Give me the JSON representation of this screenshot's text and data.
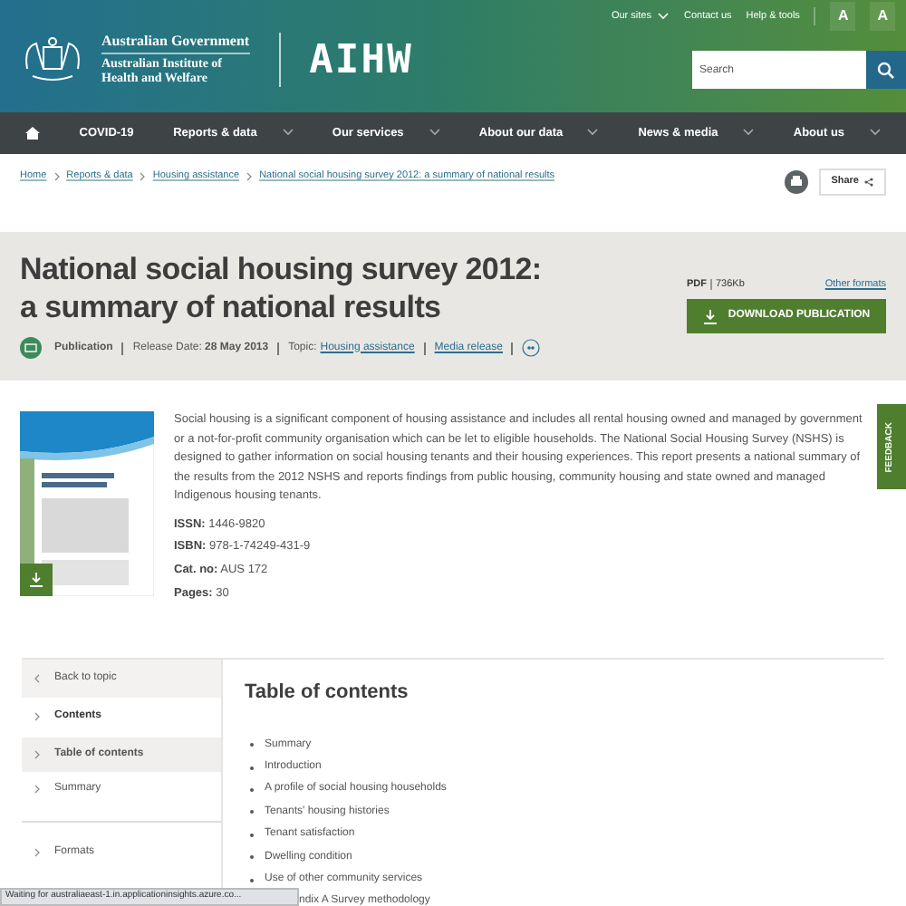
{
  "top_links": [
    {
      "label": "Our sites",
      "dropdown": true
    },
    {
      "label": "Contact us",
      "dropdown": false
    },
    {
      "label": "Help & tools",
      "dropdown": false
    }
  ],
  "font_buttons": [
    "A",
    "A"
  ],
  "logo": {
    "government": "Australian Government",
    "institute": "Australian Institute of Health and Welfare",
    "brand": "AIHW"
  },
  "search": {
    "placeholder": "Search"
  },
  "nav": [
    {
      "label": "COVID-19",
      "dropdown": false
    },
    {
      "label": "Reports & data",
      "dropdown": true
    },
    {
      "label": "Our services",
      "dropdown": true
    },
    {
      "label": "About our data",
      "dropdown": true
    },
    {
      "label": "News & media",
      "dropdown": true
    },
    {
      "label": "About us",
      "dropdown": true
    }
  ],
  "breadcrumb": [
    "Home",
    "Reports & data",
    "Housing assistance",
    "National social housing survey 2012: a summary of national results"
  ],
  "share": "Share",
  "title": "National social housing survey 2012: a summary of national results",
  "meta": {
    "type": "Publication",
    "release_label": "Release Date:",
    "release_date": "28 May 2013",
    "topic_label": "Topic:",
    "topic": "Housing assistance",
    "media": "Media release"
  },
  "download": {
    "format": "PDF",
    "size": "736Kb",
    "other": "Other formats",
    "button": "DOWNLOAD PUBLICATION"
  },
  "cover": {
    "kind": "picture"
  },
  "summary": "Social housing is a significant component of housing assistance and includes all rental housing owned and managed by government or a not-for-profit community organisation which can be let to eligible households. The National Social Housing Survey (NSHS) is designed to gather information on social housing tenants and their housing experiences. This report presents a national summary of the results from the 2012 NSHS and reports findings from public housing, community housing and state owned and managed Indigenous housing tenants.",
  "facts": [
    {
      "label": "ISSN:",
      "value": "1446-9820"
    },
    {
      "label": "ISBN:",
      "value": "978-1-74249-431-9"
    },
    {
      "label": "Cat. no:",
      "value": "AUS 172"
    },
    {
      "label": "Pages:",
      "value": "30"
    }
  ],
  "feedback": "FEEDBACK",
  "sidebar": [
    {
      "label": "Back to topic",
      "kind": "back",
      "selected": false
    },
    {
      "label": "Contents",
      "kind": "heading",
      "selected": false
    },
    {
      "label": "Table of contents",
      "kind": "item",
      "selected": true
    },
    {
      "label": "Summary",
      "kind": "item",
      "selected": false
    },
    {
      "label": "Formats",
      "kind": "section",
      "selected": false
    }
  ],
  "toc": {
    "heading": "Table of contents",
    "items": [
      "Summary",
      "Introduction",
      "A profile of social housing households",
      "Tenants' housing histories",
      "Tenant satisfaction",
      "Dwelling condition",
      "Use of other community services",
      {
        "text": "ndix A Survey methodology",
        "clipped": true
      }
    ]
  },
  "status_bar": "Waiting for australiaeast-1.in.applicationinsights.azure.co..."
}
